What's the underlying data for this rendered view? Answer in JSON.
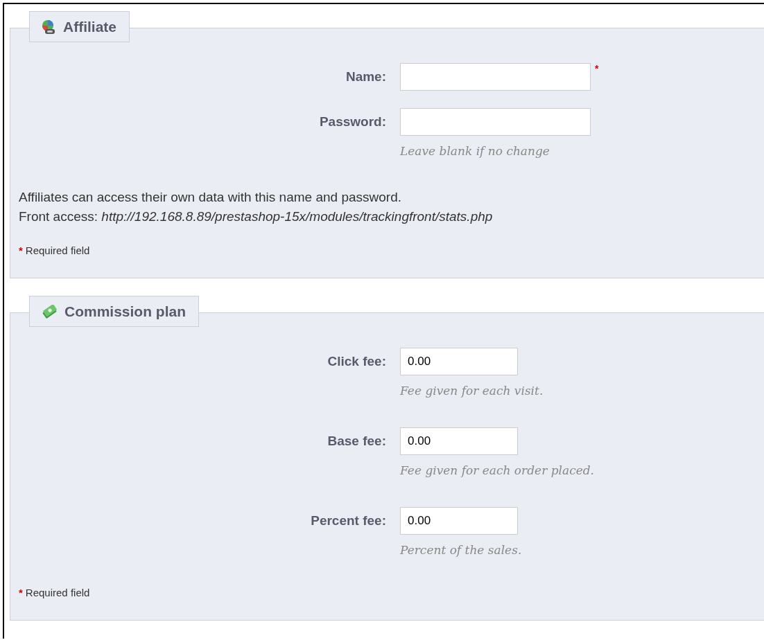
{
  "sections": [
    {
      "title": "Affiliate",
      "fields": [
        {
          "label": "Name:",
          "kind": "text",
          "mark": "*"
        },
        {
          "label": "Password:",
          "kind": "text",
          "hint": "Leave blank if no change"
        }
      ],
      "notes": [
        "Affiliates can access their own data with this name and password.",
        "Front access: *http://192.168.8.89/prestashop-15x/modules/trackingfront/stats.php*"
      ],
      "required_mark": "*",
      "required_text": "Required field"
    },
    {
      "title": "Commission plan",
      "fields": [
        {
          "label": "Click fee:",
          "kind": "amount",
          "value": "0.00",
          "hint": "Fee given for each visit."
        },
        {
          "label": "Base fee:",
          "kind": "amount",
          "value": "0.00",
          "hint": "Fee given for each order placed."
        },
        {
          "label": "Percent fee:",
          "kind": "amount",
          "value": "0.00",
          "hint": "Percent of the sales."
        }
      ],
      "required_mark": "*",
      "required_text": "Required field"
    }
  ]
}
